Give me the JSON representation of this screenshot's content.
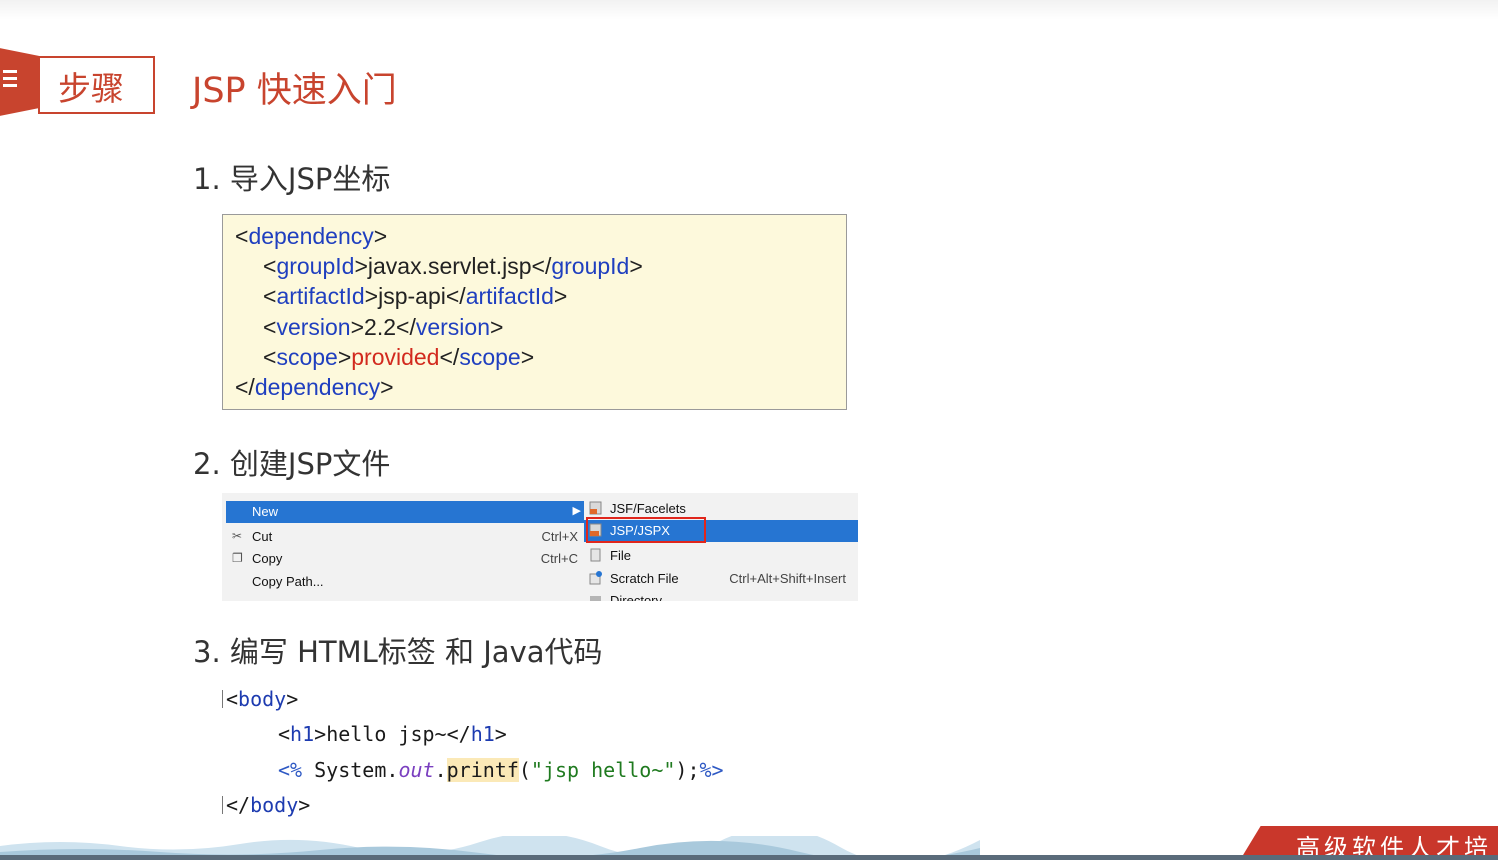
{
  "header": {
    "tag": "步骤",
    "title": "JSP 快速入门"
  },
  "steps": [
    "1. 导入JSP坐标",
    "2. 创建JSP文件",
    "3. 编写 HTML标签 和 Java代码"
  ],
  "xml": {
    "dependency_tag": "dependency",
    "groupId_tag": "groupId",
    "groupId_value": "javax.servlet.jsp",
    "artifactId_tag": "artifactId",
    "artifactId_value": "jsp-api",
    "version_tag": "version",
    "version_value": "2.2",
    "scope_tag": "scope",
    "scope_value": "provided"
  },
  "context_menu": {
    "items": [
      {
        "label": "New",
        "shortcut": "",
        "icon": "none"
      },
      {
        "label": "Cut",
        "shortcut": "Ctrl+X",
        "icon": "scissors-icon"
      },
      {
        "label": "Copy",
        "shortcut": "Ctrl+C",
        "icon": "copy-icon"
      },
      {
        "label": "Copy Path...",
        "shortcut": "",
        "icon": "none"
      }
    ],
    "submenu": [
      {
        "label": "JSF/Facelets",
        "shortcut": "",
        "icon": "jsf-file-icon"
      },
      {
        "label": "JSP/JSPX",
        "shortcut": "",
        "icon": "jsp-file-icon"
      },
      {
        "label": "File",
        "shortcut": "",
        "icon": "file-icon"
      },
      {
        "label": "Scratch File",
        "shortcut": "Ctrl+Alt+Shift+Insert",
        "icon": "scratch-file-icon"
      },
      {
        "label": "Directory",
        "shortcut": "",
        "icon": "folder-icon"
      }
    ],
    "selected_item": "New",
    "selected_subitem": "JSP/JSPX",
    "highlight_color": "#2675d2"
  },
  "code": {
    "body_tag": "body",
    "h1_tag": "h1",
    "h1_text": "hello jsp~",
    "scriptlet_open": "<%",
    "system": "System",
    "out": "out",
    "printf": "printf",
    "string_literal": "\"jsp hello~\"",
    "scriptlet_close": "%>"
  },
  "footer": {
    "text": "高级软件人才培"
  },
  "colors": {
    "accent": "#c8442e",
    "xml_bg": "#fdf9dc",
    "tag_blue": "#1f3fbf",
    "value_red": "#d22a1e"
  }
}
